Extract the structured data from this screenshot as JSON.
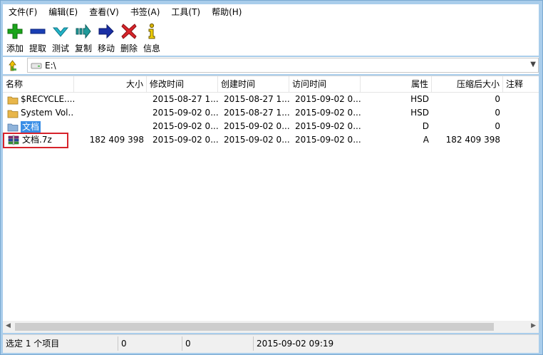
{
  "menu": [
    "文件(F)",
    "编辑(E)",
    "查看(V)",
    "书签(A)",
    "工具(T)",
    "帮助(H)"
  ],
  "toolbar": {
    "add": {
      "label": "添加",
      "icon": "plus-icon",
      "color": "#1aa51a"
    },
    "extract": {
      "label": "提取",
      "icon": "minus-icon",
      "color": "#1a3fb5"
    },
    "test": {
      "label": "测试",
      "icon": "check-icon",
      "color": "#22b4c8"
    },
    "copy": {
      "label": "复制",
      "icon": "copy-arrow-icon",
      "color": "#1f9a9a"
    },
    "move": {
      "label": "移动",
      "icon": "move-arrow-icon",
      "color": "#1a2fa5"
    },
    "delete": {
      "label": "删除",
      "icon": "delete-x-icon",
      "color": "#d8242a"
    },
    "info": {
      "label": "信息",
      "icon": "info-icon",
      "color": "#d9b400"
    }
  },
  "address": {
    "path": "E:\\"
  },
  "columns": {
    "name": "名称",
    "size": "大小",
    "modified": "修改时间",
    "created": "创建时间",
    "accessed": "访问时间",
    "attributes": "属性",
    "packed_size": "压缩后大小",
    "comment": "注释"
  },
  "files": [
    {
      "name": "$RECYCLE....",
      "size": "",
      "modified": "2015-08-27 1...",
      "created": "2015-08-27 1...",
      "accessed": "2015-09-02 0...",
      "attributes": "HSD",
      "packed_size": "0",
      "icon": "folder-icon"
    },
    {
      "name": "System Vol...",
      "size": "",
      "modified": "2015-09-02 0...",
      "created": "2015-08-27 1...",
      "accessed": "2015-09-02 0...",
      "attributes": "HSD",
      "packed_size": "0",
      "icon": "folder-icon"
    },
    {
      "name": "文档",
      "size": "",
      "modified": "2015-09-02 0...",
      "created": "2015-09-02 0...",
      "accessed": "2015-09-02 0...",
      "attributes": "D",
      "packed_size": "0",
      "icon": "folder-blue-icon"
    },
    {
      "name": "文档.7z",
      "size": "182 409 398",
      "modified": "2015-09-02 0...",
      "created": "2015-09-02 0...",
      "accessed": "2015-09-02 0...",
      "attributes": "A",
      "packed_size": "182 409 398",
      "icon": "archive-icon"
    }
  ],
  "status": {
    "selection": "选定 1 个项目",
    "size": "0",
    "packed": "0",
    "modified": "2015-09-02 09:19"
  }
}
